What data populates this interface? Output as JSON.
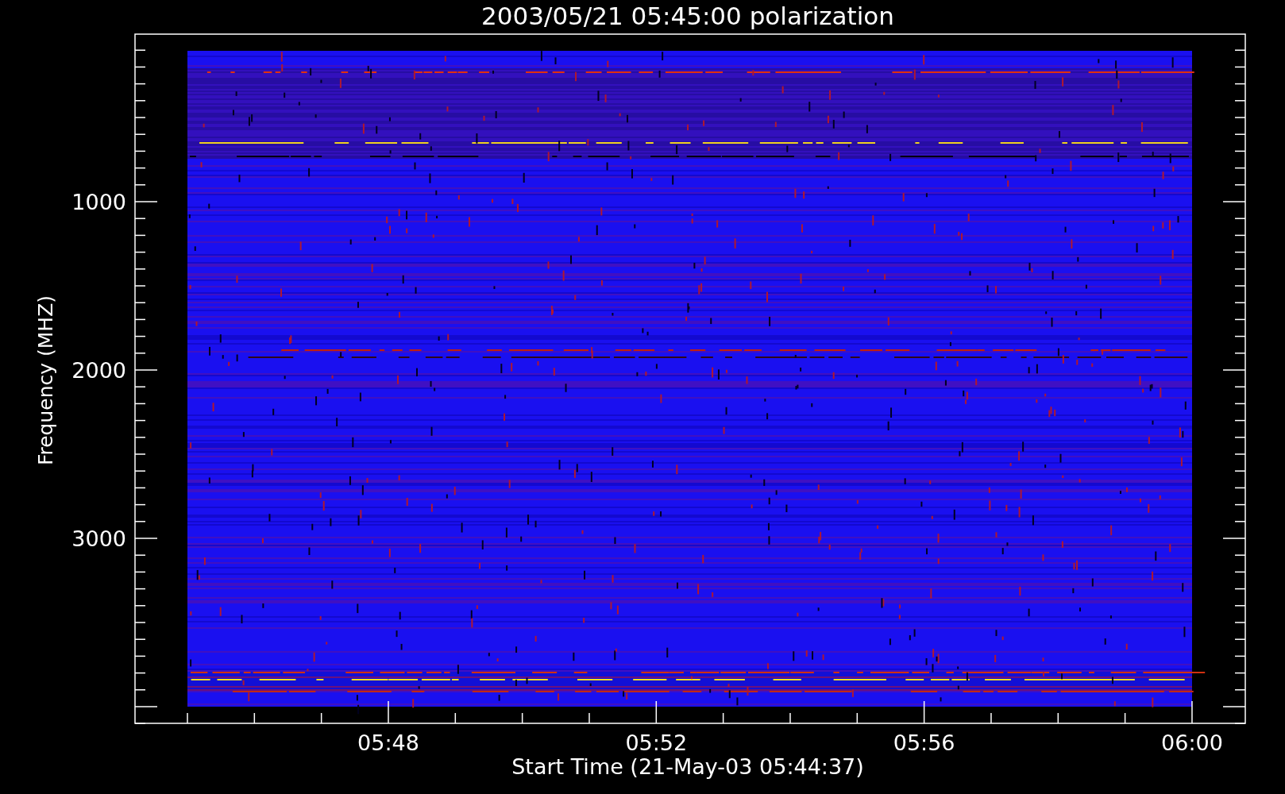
{
  "title": "2003/05/21 05:45:00 polarization",
  "y_axis": {
    "label": "Frequency (MHZ)",
    "ticks": [
      "1000",
      "2000",
      "3000"
    ]
  },
  "x_axis": {
    "label": "Start Time (21-May-03 05:44:37)",
    "ticks": [
      "05:48",
      "05:52",
      "05:56",
      "06:00"
    ]
  }
}
